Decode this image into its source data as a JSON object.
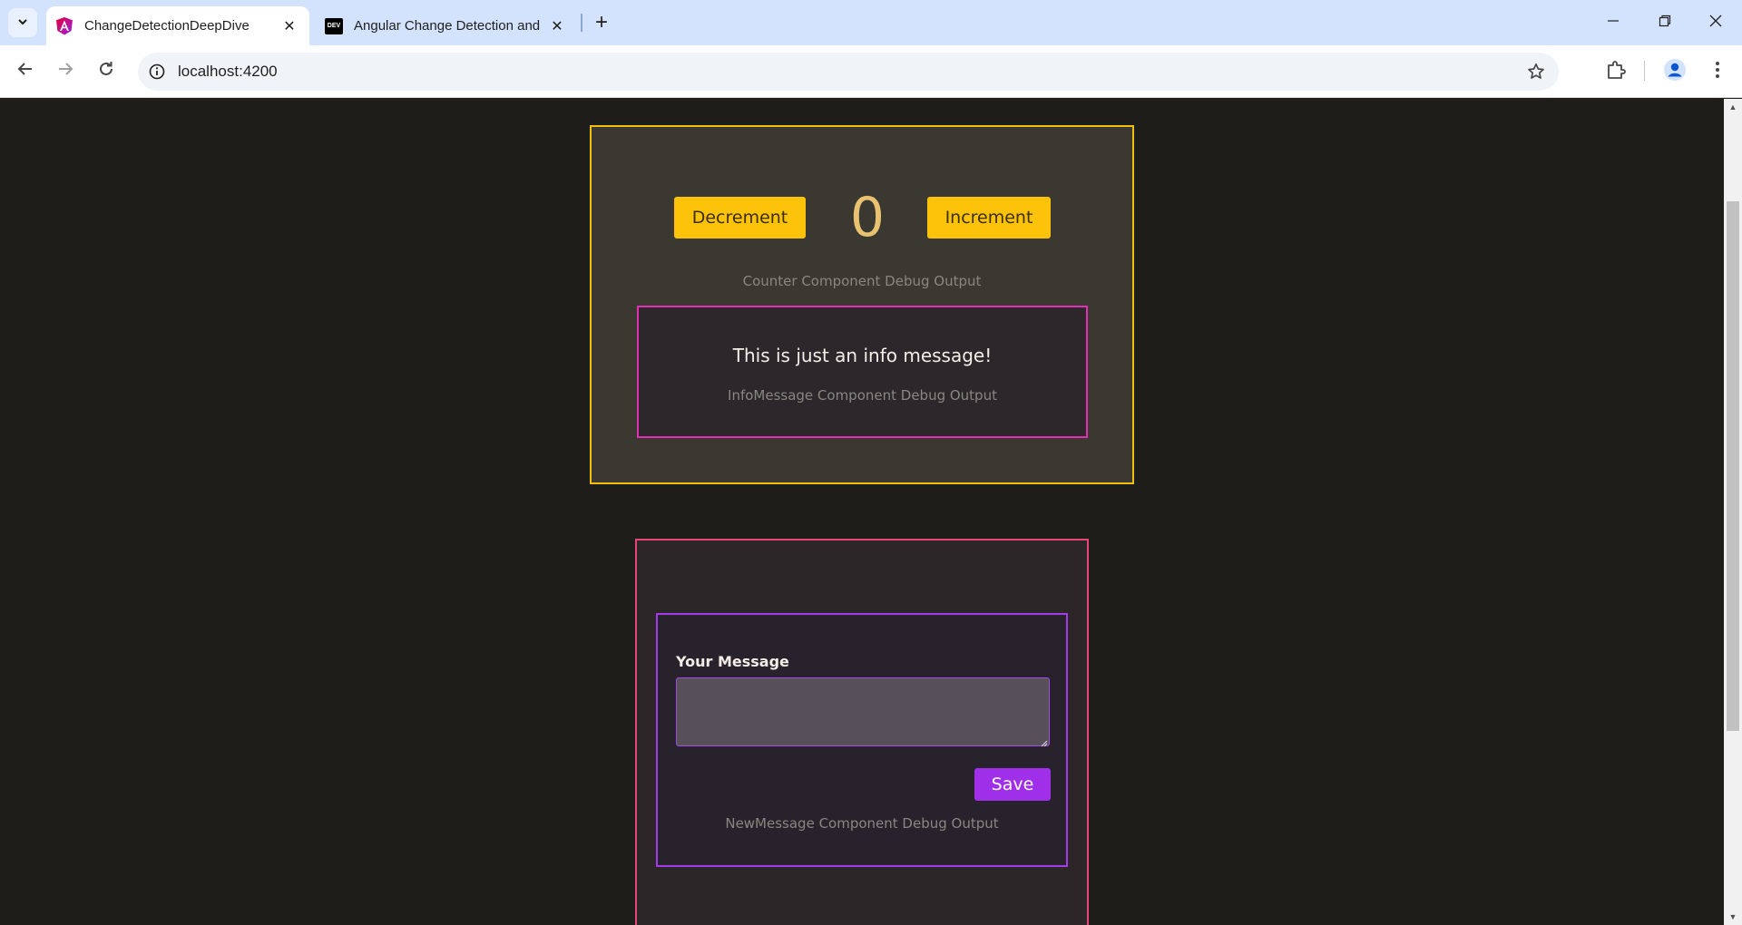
{
  "browser": {
    "tabs": [
      {
        "title": "ChangeDetectionDeepDive",
        "active": true,
        "favicon": "angular-logo-icon"
      },
      {
        "title": "Angular Change Detection and",
        "active": false,
        "favicon": "dev-logo-icon",
        "favicon_text": "DEV"
      }
    ],
    "url": "localhost:4200"
  },
  "colors": {
    "counter_border": "#f0bf0e",
    "counter_button": "#fdc30b",
    "counter_value": "#e9c271",
    "info_border": "#e22fb5",
    "messages_border": "#e8457a",
    "new_message_border": "#a33bea",
    "save_button": "#9f2fe8",
    "list_border": "#27d39e",
    "page_background": "#1e1d1a"
  },
  "counter": {
    "decrement_label": "Decrement",
    "increment_label": "Increment",
    "value": "0",
    "debug": "Counter Component Debug Output"
  },
  "info_message": {
    "text": "This is just an info message!",
    "debug": "InfoMessage Component Debug Output"
  },
  "new_message": {
    "label": "Your Message",
    "value": "",
    "save_label": "Save",
    "debug": "NewMessage Component Debug Output"
  }
}
